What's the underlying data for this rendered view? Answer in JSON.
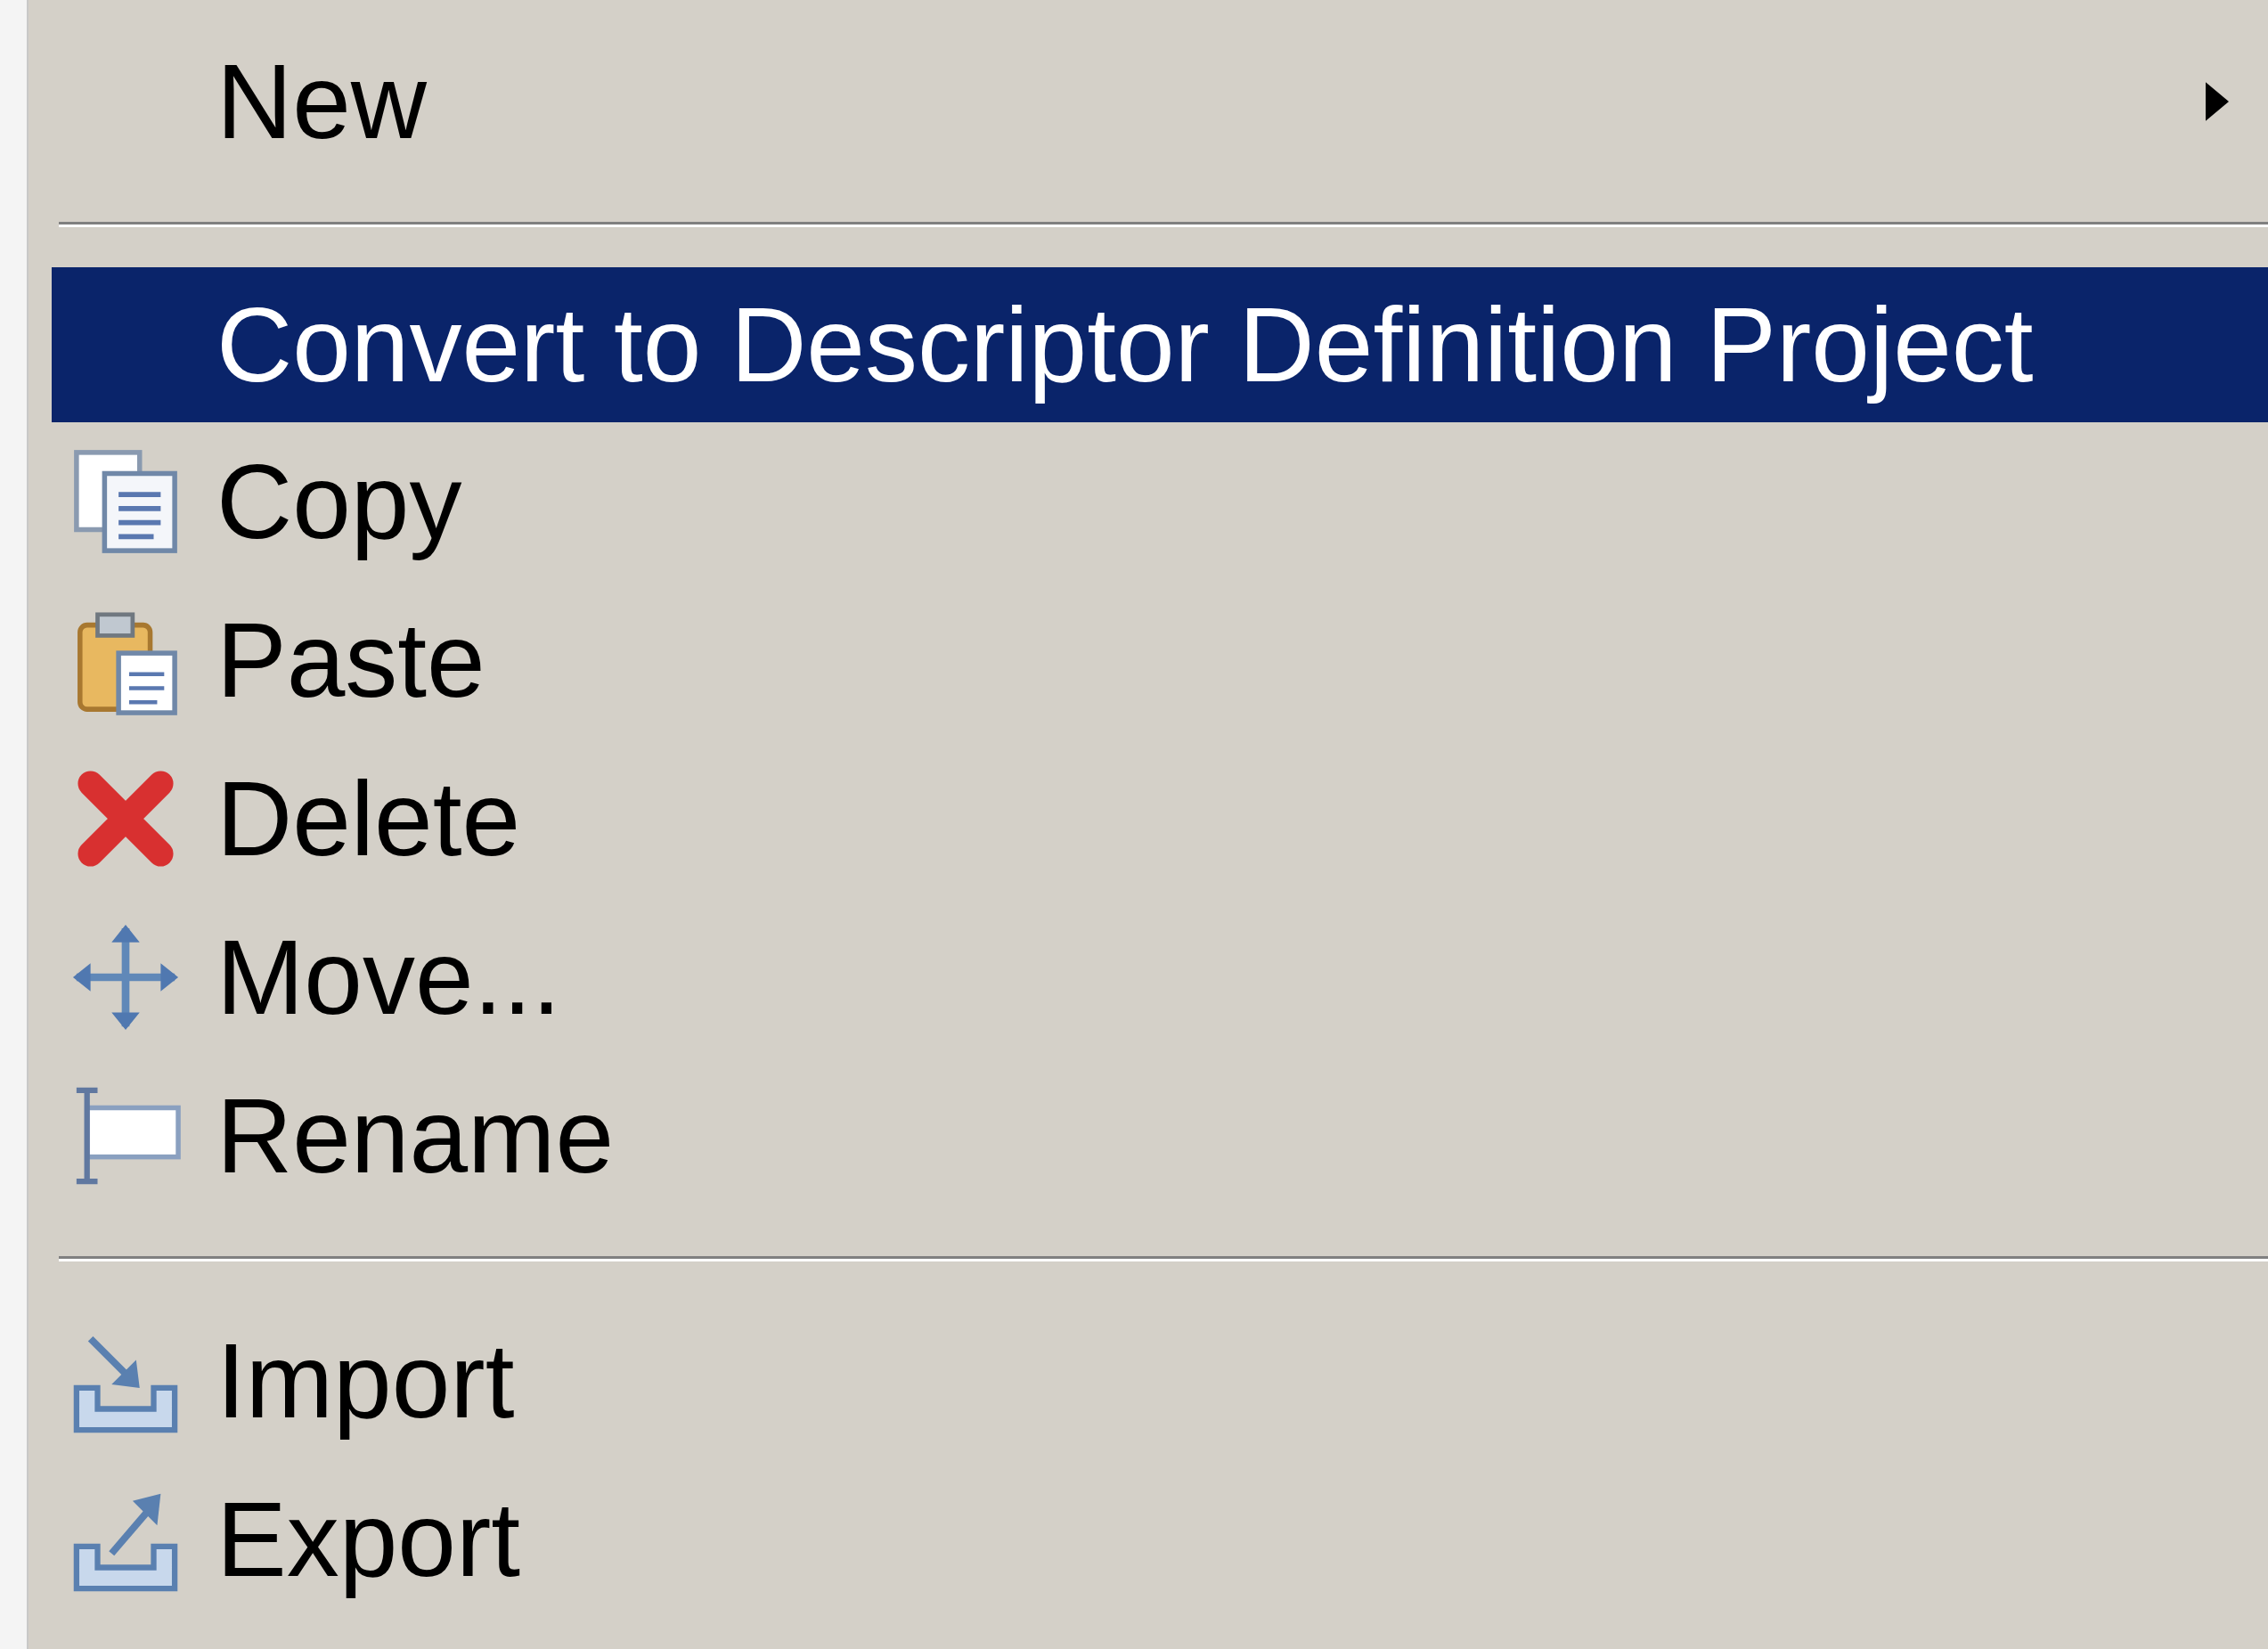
{
  "menu": {
    "items": [
      {
        "kind": "item",
        "label": "New",
        "selected": false,
        "submenu": true
      },
      {
        "kind": "separator"
      },
      {
        "kind": "item",
        "label": "Convert to Descriptor Definition Project",
        "selected": true,
        "submenu": false
      },
      {
        "kind": "item",
        "label": "Copy",
        "selected": false,
        "submenu": false
      },
      {
        "kind": "item",
        "label": "Paste",
        "selected": false,
        "submenu": false
      },
      {
        "kind": "item",
        "label": "Delete",
        "selected": false,
        "submenu": false
      },
      {
        "kind": "item",
        "label": "Move...",
        "selected": false,
        "submenu": false
      },
      {
        "kind": "item",
        "label": "Rename",
        "selected": false,
        "submenu": false
      },
      {
        "kind": "separator"
      },
      {
        "kind": "item",
        "label": "Import",
        "selected": false,
        "submenu": false
      },
      {
        "kind": "item",
        "label": "Export",
        "selected": false,
        "submenu": false
      }
    ]
  }
}
